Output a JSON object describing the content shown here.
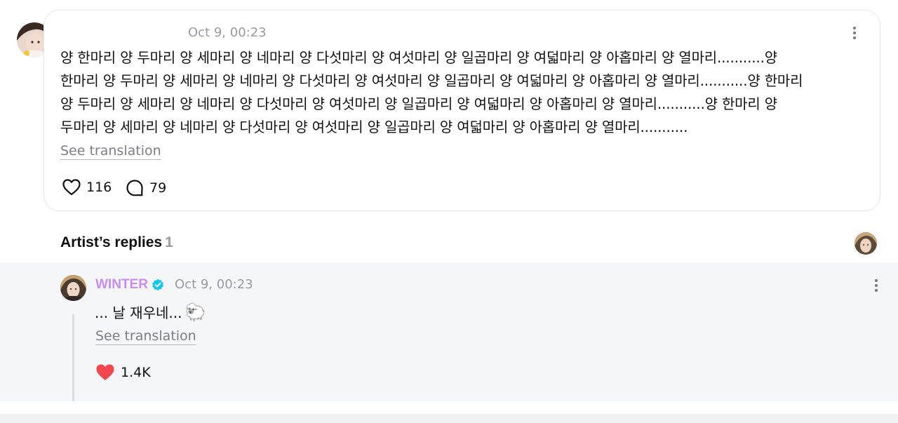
{
  "post": {
    "timestamp": "Oct 9, 00:23",
    "body": "양 한마리 양 두마리 양 세마리 양 네마리 양 다섯마리 양 여섯마리 양 일곱마리 양 여덟마리 양 아홉마리 양 열마리...........양\n한마리 양 두마리 양 세마리 양 네마리 양 다섯마리 양 여섯마리 양 일곱마리 양 여덟마리 양 아홉마리 양 열마리...........양 한마리\n양 두마리 양 세마리 양 네마리 양 다섯마리 양 여섯마리 양 일곱마리 양 여덟마리 양 아홉마리 양 열마리...........양 한마리 양\n두마리 양 세마리 양 네마리 양 다섯마리 양 여섯마리 양 일곱마리 양 여덟마리 양 아홉마리 양 열마리...........",
    "see_translation": "See translation",
    "like_count": "116",
    "comment_count": "79",
    "like_icon": "heart-outline-icon",
    "comment_icon": "comment-bubble-icon",
    "more_icon": "more-vertical-icon"
  },
  "replies": {
    "title": "Artist’s replies",
    "count": "1"
  },
  "reply": {
    "author": "WINTER",
    "author_color": "#c98cf0",
    "verified_icon": "verified-badge-icon",
    "verified_color": "#14c6e8",
    "timestamp": "Oct 9, 00:23",
    "text": "... 날 재우네...",
    "emoji": "🐑",
    "see_translation": "See translation",
    "like_count": "1.4K",
    "like_icon": "heart-filled-icon",
    "like_color": "#f2474f",
    "more_icon": "more-vertical-icon"
  }
}
